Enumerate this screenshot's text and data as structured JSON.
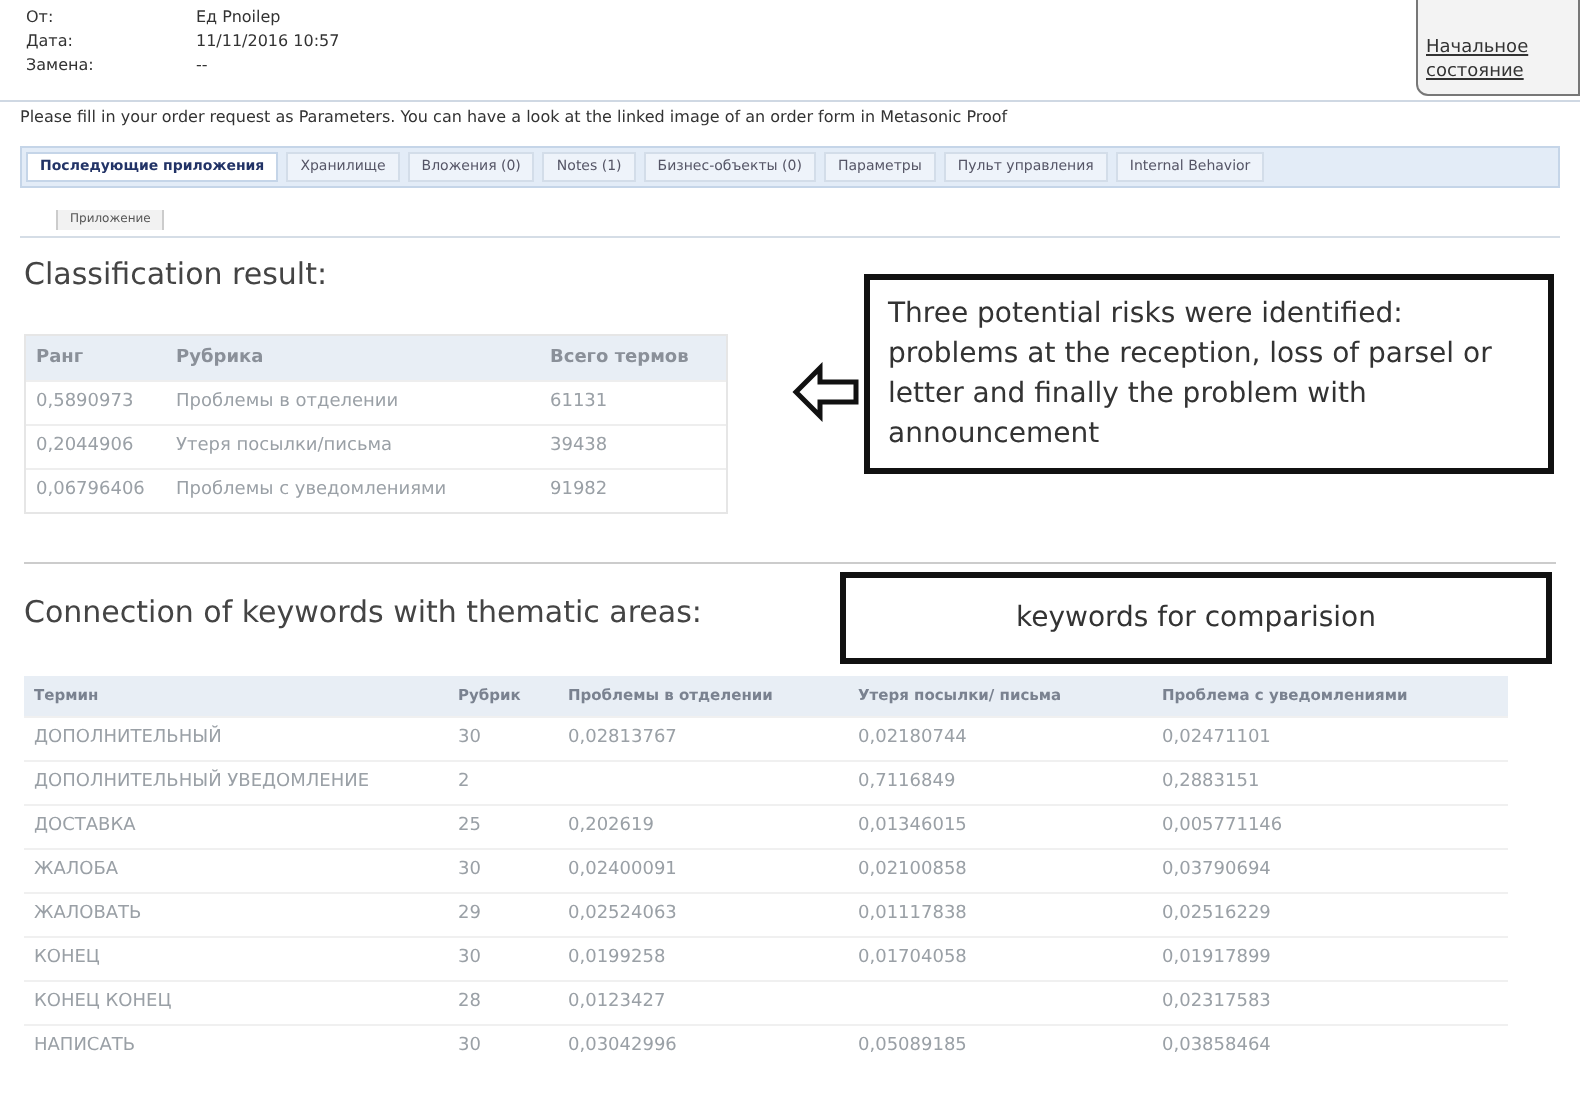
{
  "header": {
    "fields": [
      {
        "label": "От:",
        "value": "Ед Pnoilep"
      },
      {
        "label": "Дата:",
        "value": "11/11/2016 10:57"
      },
      {
        "label": "Замена:",
        "value": "--"
      }
    ],
    "reset_button": "Начальное состояние"
  },
  "instruction": "Please fill in your order request as Parameters. You can have a look at the linked image of an order form in Metasonic Proof",
  "tabs": [
    {
      "label": "Последующие приложения",
      "selected": true
    },
    {
      "label": "Хранилище",
      "selected": false
    },
    {
      "label": "Вложения (0)",
      "selected": false
    },
    {
      "label": "Notes (1)",
      "selected": false
    },
    {
      "label": "Бизнес-объекты (0)",
      "selected": false
    },
    {
      "label": "Параметры",
      "selected": false
    },
    {
      "label": "Пульт управления",
      "selected": false
    },
    {
      "label": "Internal Behavior",
      "selected": false
    }
  ],
  "subtab": "Приложение",
  "classification": {
    "title": "Classification result:",
    "columns": [
      "Ранг",
      "Рубрика",
      "Всего термов"
    ],
    "rows": [
      [
        "0,5890973",
        "Проблемы в отделении",
        "61131"
      ],
      [
        "0,2044906",
        "Утеря посылки/письма",
        "39438"
      ],
      [
        "0,06796406",
        "Проблемы с уведомлениями",
        "91982"
      ]
    ],
    "note": "Three potential risks were identified: problems at the reception, loss of parsel or letter and finally the problem with announcement"
  },
  "keywords": {
    "title": "Connection of keywords with thematic areas:",
    "note": "keywords for comparision",
    "columns": [
      "Термин",
      "Рубрик",
      "Проблемы в отделении",
      "Утеря посылки/ письма",
      "Проблема с уведомлениями"
    ],
    "rows": [
      [
        "ДОПОЛНИТЕЛЬНЫЙ",
        "30",
        "0,02813767",
        "0,02180744",
        "0,02471101"
      ],
      [
        "ДОПОЛНИТЕЛЬНЫЙ УВЕДОМЛЕНИЕ",
        "2",
        "",
        "0,7116849",
        "0,2883151"
      ],
      [
        "ДОСТАВКА",
        "25",
        "0,202619",
        "0,01346015",
        "0,005771146"
      ],
      [
        "ЖАЛОБА",
        "30",
        "0,02400091",
        "0,02100858",
        "0,03790694"
      ],
      [
        "ЖАЛОВАТЬ",
        "29",
        "0,02524063",
        "0,01117838",
        "0,02516229"
      ],
      [
        "КОНЕЦ",
        "30",
        "0,0199258",
        "0,01704058",
        "0,01917899"
      ],
      [
        "КОНЕЦ КОНЕЦ",
        "28",
        "0,0123427",
        "",
        "0,02317583"
      ],
      [
        "НАПИСАТЬ",
        "30",
        "0,03042996",
        "0,05089185",
        "0,03858464"
      ]
    ]
  }
}
